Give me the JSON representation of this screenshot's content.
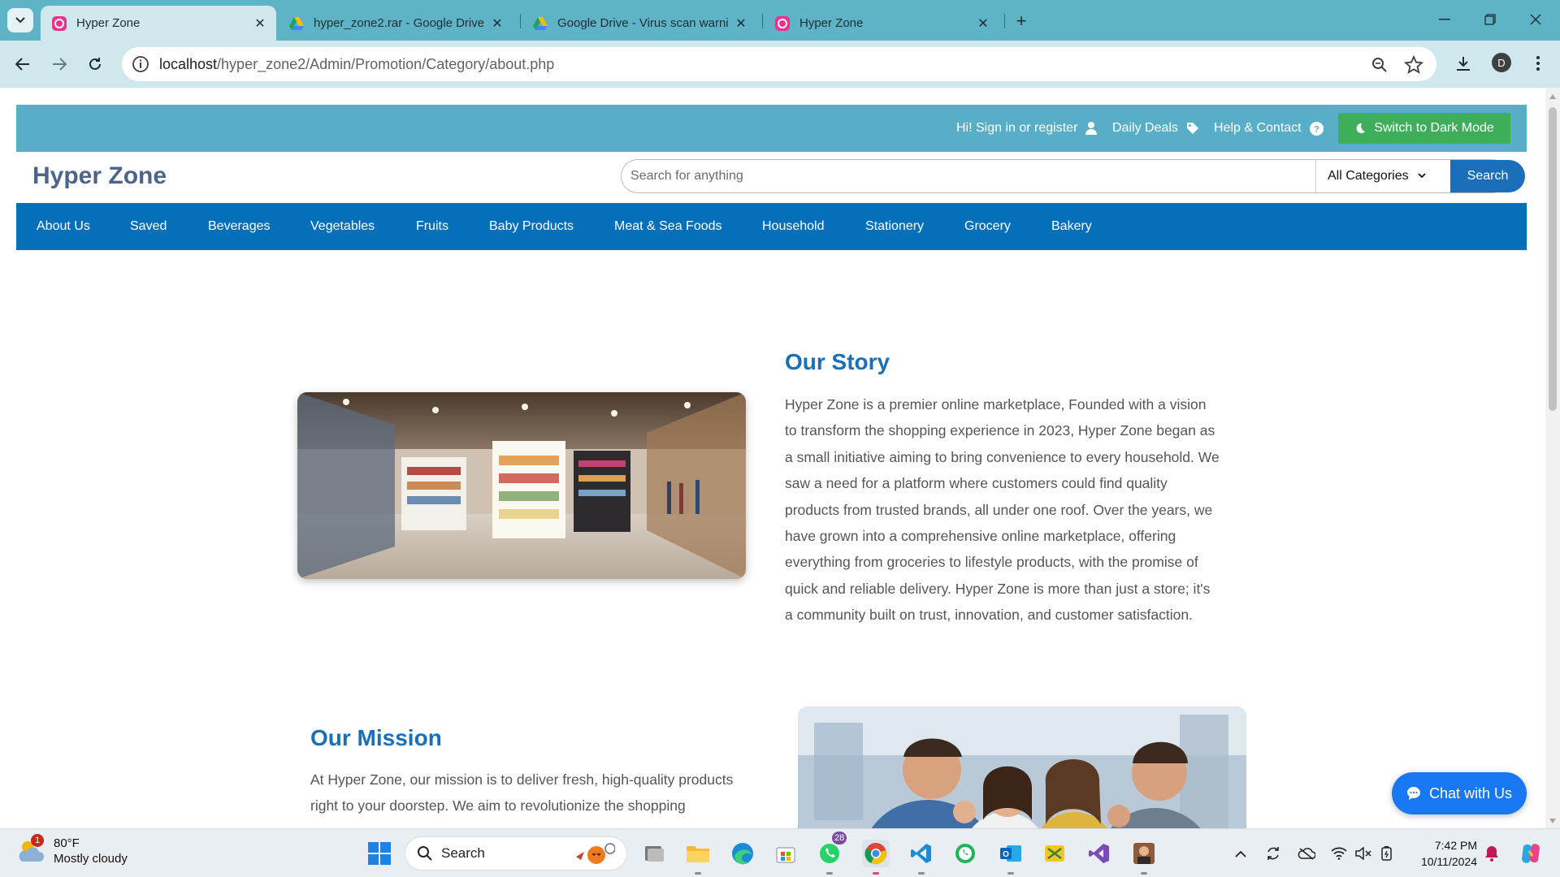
{
  "browser": {
    "tabs": [
      {
        "title": "Hyper Zone",
        "active": true,
        "favicon": "hyperzone-favicon"
      },
      {
        "title": "hyper_zone2.rar - Google Drive",
        "active": false,
        "favicon": "google-drive-favicon"
      },
      {
        "title": "Google Drive - Virus scan warni",
        "active": false,
        "favicon": "google-drive-favicon"
      },
      {
        "title": "Hyper Zone",
        "active": false,
        "favicon": "hyperzone-favicon"
      }
    ],
    "url_host": "localhost",
    "url_path": "/hyper_zone2/Admin/Promotion/Category/about.php",
    "profile_initial": "D"
  },
  "site": {
    "top_links": {
      "signin": "Hi! Sign in or register",
      "deals": "Daily Deals",
      "help": "Help & Contact",
      "dark_mode": "Switch to Dark Mode"
    },
    "brand": "Hyper Zone",
    "search": {
      "placeholder": "Search for anything",
      "category": "All Categories",
      "button": "Search"
    },
    "nav": [
      "About Us",
      "Saved",
      "Beverages",
      "Vegetables",
      "Fruits",
      "Baby Products",
      "Meat & Sea Foods",
      "Household",
      "Stationery",
      "Grocery",
      "Bakery"
    ],
    "story": {
      "heading": "Our Story",
      "lines": [
        "Hyper Zone is a premier online marketplace, Founded with a vision",
        "to transform the shopping experience in 2023, Hyper Zone began as",
        "a small initiative aiming to bring convenience to every household. We",
        "saw a need for a platform where customers could find quality",
        "products from trusted brands, all under one roof. Over the years, we",
        "have grown into a comprehensive online marketplace, offering",
        "everything from groceries to lifestyle products, with the promise of",
        "quick and reliable delivery. Hyper Zone is more than just a store; it's",
        "a community built on trust, innovation, and customer satisfaction."
      ]
    },
    "mission": {
      "heading": "Our Mission",
      "lines": [
        "At Hyper Zone, our mission is to deliver fresh, high-quality products",
        "right to your doorstep. We aim to revolutionize the shopping"
      ]
    },
    "chat_button": "Chat with Us",
    "colors": {
      "top_strip": "#58aec7",
      "nav_bar": "#0570b9",
      "dark_mode_button": "#3fae5a",
      "heading": "#1a6fb8",
      "chat": "#1877f2"
    }
  },
  "taskbar": {
    "weather": {
      "temp": "80°F",
      "condition": "Mostly cloudy",
      "badge": "1"
    },
    "search_label": "Search",
    "whatsapp_badge": "28",
    "time": "7:42 PM",
    "date": "10/11/2024"
  }
}
